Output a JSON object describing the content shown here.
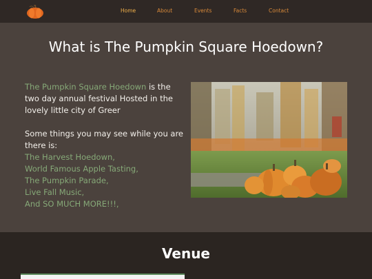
{
  "nav": {
    "home": "Home",
    "about": "About",
    "events": "Events",
    "facts": "Facts",
    "contact": "Contact"
  },
  "intro": {
    "title": "What is The Pumpkin Square Hoedown?",
    "p1_link": "The Pumpkin Square Hoedown",
    "p1_rest": " is the two day annual festival Hosted in the lovely little city of Greer",
    "p2": "Some things you may see while you are there is:",
    "items": [
      "The Harvest Hoedown,",
      "World Famous Apple Tasting,",
      "The Pumpkin Parade,",
      "Live Fall Music,",
      "And SO MUCH MORE!!!,"
    ]
  },
  "venue": {
    "title": "Venue"
  },
  "colors": {
    "nav_bg": "#2f2825",
    "section_bg": "#4b423d",
    "accent_green": "#86a978",
    "nav_orange": "#d98a3a"
  },
  "icons": {
    "logo": "pumpkin-logo-icon"
  }
}
